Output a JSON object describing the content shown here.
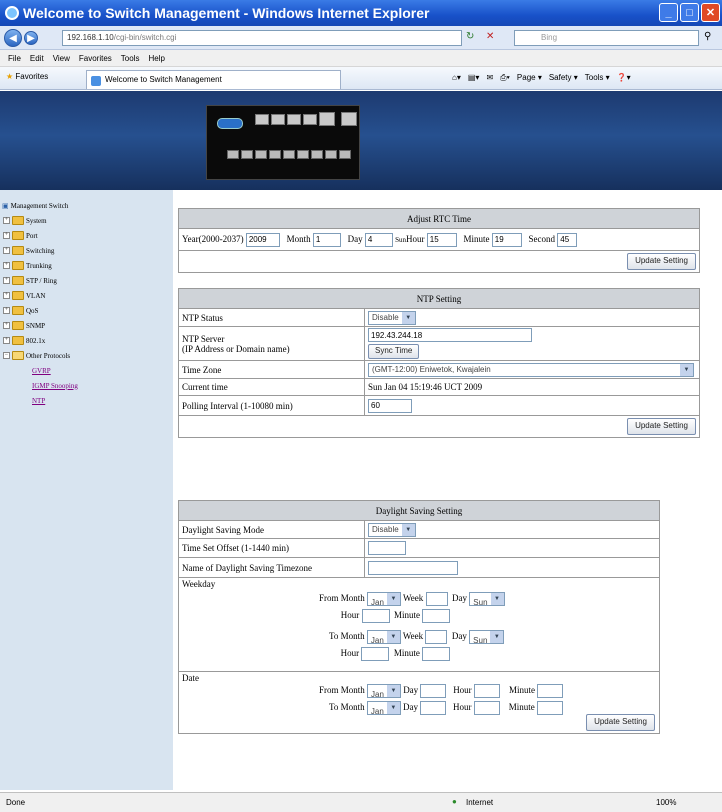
{
  "window": {
    "title": "Welcome to Switch Management - Windows Internet Explorer"
  },
  "address": {
    "host": "192.168.1.10",
    "rest": "/cgi-bin/switch.cgi"
  },
  "search": {
    "placeholder": "Bing"
  },
  "menu": [
    "File",
    "Edit",
    "View",
    "Favorites",
    "Tools",
    "Help"
  ],
  "favbar": {
    "favorites": "Favorites",
    "tab": "Welcome to Switch Management",
    "page": "Page ▾",
    "safety": "Safety ▾",
    "tools": "Tools ▾"
  },
  "sidebar": {
    "root": "Management Switch",
    "folders": [
      "System",
      "Port",
      "Switching",
      "Trunking",
      "STP / Ring",
      "VLAN",
      "QoS",
      "SNMP",
      "802.1x",
      "Other Protocols"
    ],
    "links": [
      "GVRP",
      "IGMP Snooping",
      "NTP"
    ]
  },
  "rtc": {
    "header": "Adjust RTC Time",
    "year_label": "Year(2000-2037)",
    "year": "2009",
    "month_label": "Month",
    "month": "1",
    "day_label": "Day",
    "day": "4",
    "weekday": "Sun",
    "hour_label": "Hour",
    "hour": "15",
    "minute_label": "Minute",
    "minute": "19",
    "second_label": "Second",
    "second": "45",
    "update": "Update Setting"
  },
  "ntp": {
    "header": "NTP Setting",
    "status_label": "NTP Status",
    "status": "Disable",
    "server_label": "NTP Server",
    "server_sub": "(IP Address or Domain name)",
    "server": "192.43.244.18",
    "sync": "Sync Time",
    "tz_label": "Time Zone",
    "tz": "(GMT-12:00) Eniwetok, Kwajalein",
    "current_label": "Current time",
    "current": "Sun Jan 04 15:19:46 UCT 2009",
    "poll_label": "Polling Interval (1-10080 min)",
    "poll": "60",
    "update": "Update Setting"
  },
  "dst": {
    "header": "Daylight Saving Setting",
    "mode_label": "Daylight Saving Mode",
    "mode": "Disable",
    "offset_label": "Time Set Offset (1-1440 min)",
    "name_label": "Name of Daylight Saving Timezone",
    "weekday_label": "Weekday",
    "date_label": "Date",
    "from": "From",
    "to": "To",
    "month": "Month",
    "week": "Week",
    "day": "Day",
    "hour": "Hour",
    "minute": "Minute",
    "jan": "Jan",
    "sun": "Sun",
    "update": "Update Setting"
  },
  "status": {
    "left": "Done",
    "zone": "Internet",
    "zoom": "100%"
  }
}
